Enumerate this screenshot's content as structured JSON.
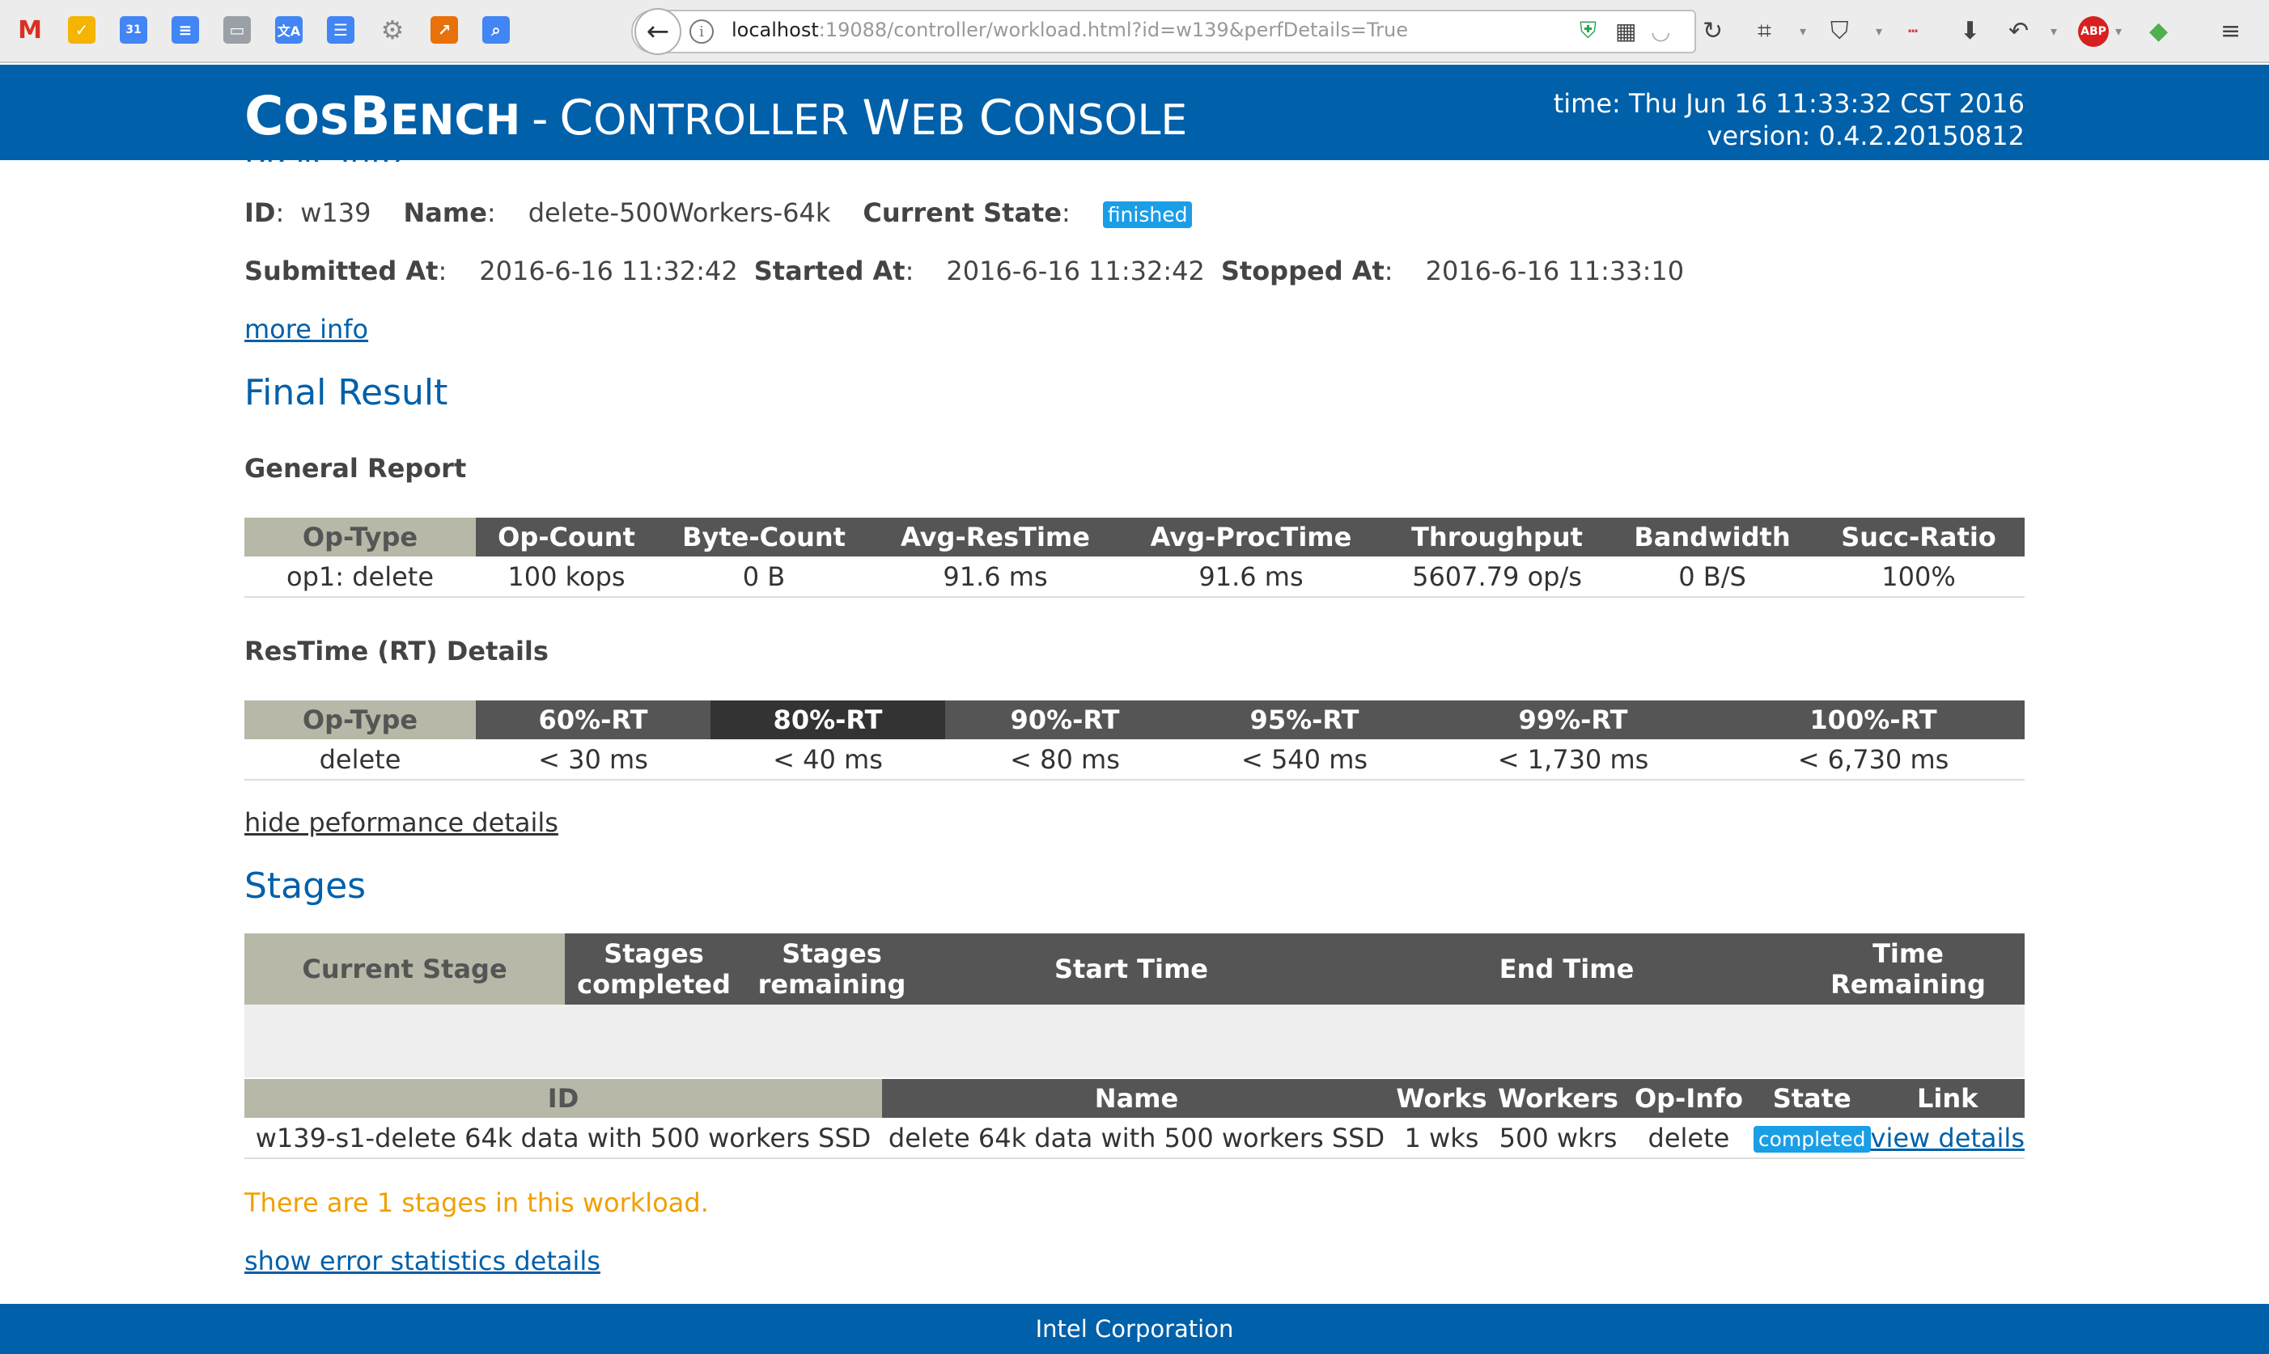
{
  "browser": {
    "url_host": "localhost",
    "url_rest": ":19088/controller/workload.html?id=w139&perfDetails=True",
    "bookmark_icons": [
      "gmail-icon",
      "keep-icon",
      "calendar-icon",
      "docs-icon",
      "slides-icon",
      "translate-icon",
      "forms-icon",
      "settings-icon",
      "analytics-icon",
      "search-icon"
    ]
  },
  "header": {
    "brand_c": "C",
    "brand_os": "OS",
    "brand_b": "B",
    "brand_ench": "ENCH",
    "brand_sep": "-",
    "brand_c2": "C",
    "brand_ontroller": "ONTROLLER",
    "brand_w": "W",
    "brand_eb": "EB",
    "brand_c3": "C",
    "brand_onsole": "ONSOLE",
    "time": "time: Thu Jun 16 11:33:32 CST 2016",
    "version": "version: 0.4.2.20150812"
  },
  "basic": {
    "partial_title": "Basic Info",
    "id_label": "ID",
    "id_value": "w139",
    "name_label": "Name",
    "name_value": "delete-500Workers-64k",
    "state_label": "Current State",
    "state_value": "finished",
    "submitted_label": "Submitted At",
    "submitted_value": "2016-6-16 11:32:42",
    "started_label": "Started At",
    "started_value": "2016-6-16 11:32:42",
    "stopped_label": "Stopped At",
    "stopped_value": "2016-6-16 11:33:10",
    "more_info": "more info"
  },
  "final_result": {
    "title": "Final Result",
    "general_report": {
      "title": "General Report",
      "headers": [
        "Op-Type",
        "Op-Count",
        "Byte-Count",
        "Avg-ResTime",
        "Avg-ProcTime",
        "Throughput",
        "Bandwidth",
        "Succ-Ratio"
      ],
      "row": [
        "op1: delete",
        "100 kops",
        "0 B",
        "91.6 ms",
        "91.6 ms",
        "5607.79 op/s",
        "0 B/S",
        "100%"
      ]
    },
    "rt_details": {
      "title": "ResTime (RT) Details",
      "headers": [
        "Op-Type",
        "60%-RT",
        "80%-RT",
        "90%-RT",
        "95%-RT",
        "99%-RT",
        "100%-RT"
      ],
      "row": [
        "delete",
        "< 30 ms",
        "< 40 ms",
        "< 80 ms",
        "< 540 ms",
        "< 1,730 ms",
        "< 6,730 ms"
      ]
    },
    "hide_link": "hide peformance details"
  },
  "stages": {
    "title": "Stages",
    "current_headers": [
      "Current Stage",
      "Stages completed",
      "Stages remaining",
      "Start Time",
      "End Time",
      "Time Remaining"
    ],
    "list_headers": [
      "ID",
      "Name",
      "Works",
      "Workers",
      "Op-Info",
      "State",
      "Link"
    ],
    "row": {
      "id": "w139-s1-delete 64k data with 500 workers SSD",
      "name": "delete 64k data with 500 workers SSD",
      "works": "1 wks",
      "workers": "500 wkrs",
      "op_info": "delete",
      "state": "completed",
      "link": "view details"
    },
    "notice": "There are 1 stages in this workload.",
    "error_link": "show error statistics details"
  },
  "footer": "Intel Corporation"
}
